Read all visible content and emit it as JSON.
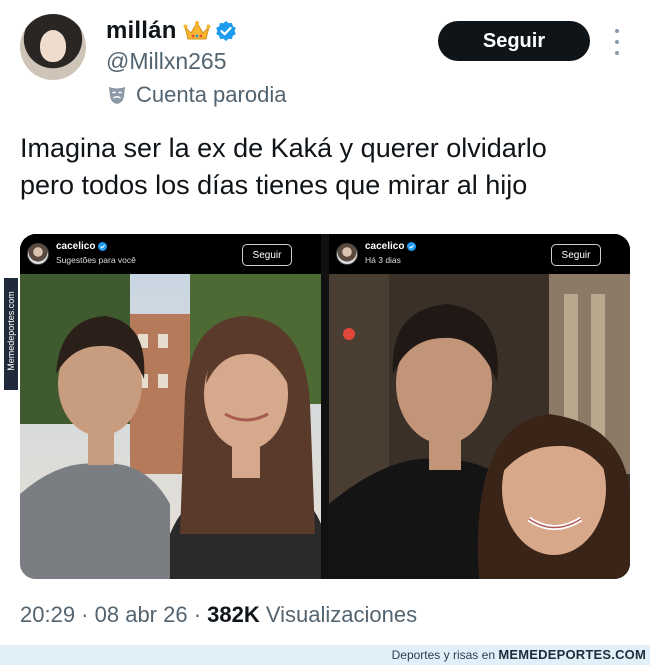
{
  "author": {
    "display_name": "millán",
    "handle": "@Millxn265",
    "parody_label": "Cuenta parodia",
    "icons": [
      "crown-emoji",
      "verified-badge-icon",
      "parody-mask-icon"
    ]
  },
  "header": {
    "follow_label": "Seguir",
    "more_icon": "more-dots-icon"
  },
  "tweet": {
    "text_line1": "Imagina ser la ex de Kaká y querer olvidarlo",
    "text_line2": "pero todos los días tienes que mirar al hijo"
  },
  "media": {
    "panels": [
      {
        "username": "cacelico",
        "subtitle": "Sugestões para você",
        "follow_label": "Seguir"
      },
      {
        "username": "cacelico",
        "subtitle": "Há 3 dias",
        "follow_label": "Seguir"
      }
    ],
    "side_watermark": "Memedeportes.com"
  },
  "meta": {
    "time": "20:29",
    "date": "08 abr 26",
    "views_count": "382K",
    "views_label": "Visualizaciones"
  },
  "footer": {
    "caption": "Deportes y risas en",
    "brand": "MEMEDEPORTES.COM"
  },
  "colors": {
    "primary_text": "#0f1419",
    "secondary_text": "#536471",
    "verified_blue": "#1d9bf0",
    "button_dark": "#0f1419",
    "footer_bg": "#e1f0f8"
  }
}
